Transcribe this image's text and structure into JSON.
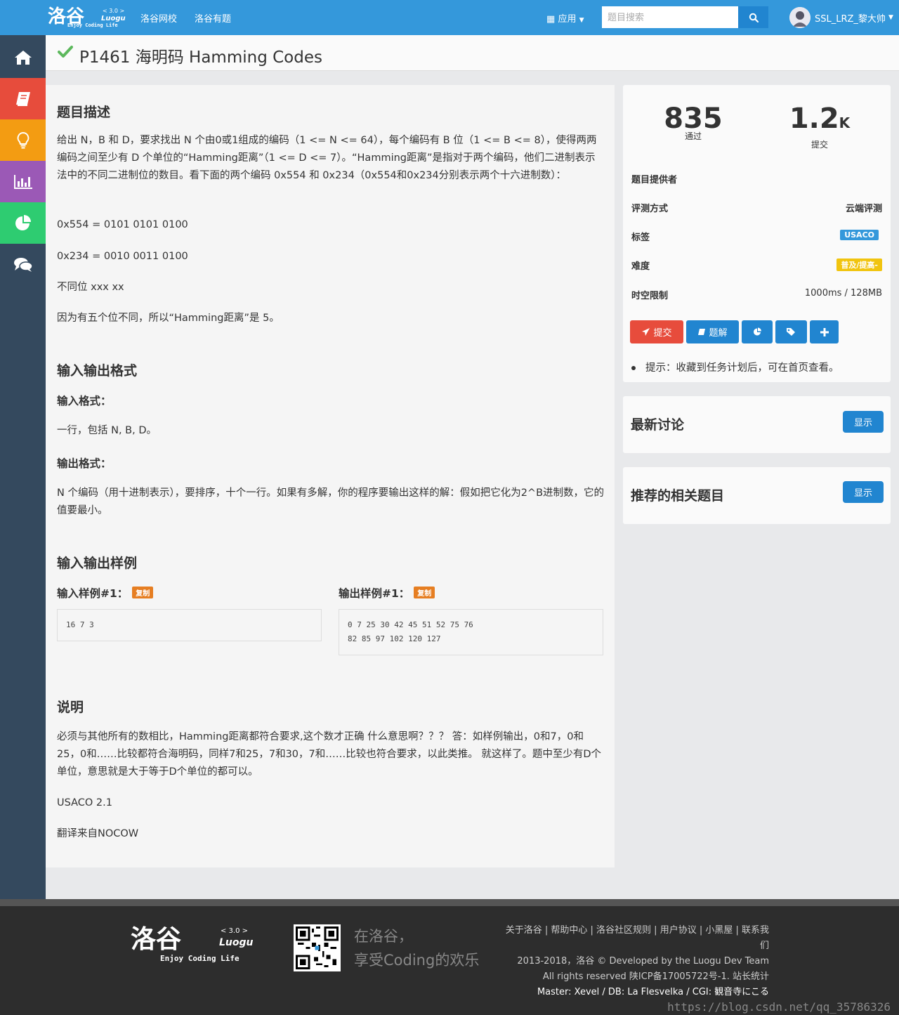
{
  "header": {
    "logo_text": "洛谷",
    "logo_version": "< 3.0 >",
    "logo_name": "Luogu",
    "logo_slogan": "Enjoy Coding Life",
    "nav": [
      "洛谷网校",
      "洛谷有题"
    ],
    "apps_label": "应用",
    "search_placeholder": "题目搜索",
    "username": "SSL_LRZ_黎大帅"
  },
  "sidebar": {
    "items": [
      {
        "icon": "home-icon",
        "color": "#34495e"
      },
      {
        "icon": "book-icon",
        "color": "#e74c3c"
      },
      {
        "icon": "lightbulb-icon",
        "color": "#f39c12"
      },
      {
        "icon": "bar-chart-icon",
        "color": "#9b59b6"
      },
      {
        "icon": "pie-chart-icon",
        "color": "#2ecc71"
      },
      {
        "icon": "comments-icon",
        "color": "#34495e"
      }
    ]
  },
  "problem": {
    "title": "P1461 海明码 Hamming Codes",
    "desc_heading": "题目描述",
    "desc_p1": "给出 N，B 和 D，要求找出 N 个由0或1组成的编码（1 <= N <= 64），每个编码有 B 位（1 <= B <= 8），使得两两编码之间至少有 D 个单位的“Hamming距离”（1 <= D <= 7）。“Hamming距离”是指对于两个编码，他们二进制表示法中的不同二进制位的数目。看下面的两个编码 0x554 和 0x234（0x554和0x234分别表示两个十六进制数）：",
    "desc_p2": "0x554 = 0101 0101 0100",
    "desc_p3": "0x234 = 0010 0011 0100",
    "desc_p4": "不同位 xxx xx",
    "desc_p5": "因为有五个位不同，所以“Hamming距离”是 5。",
    "io_heading": "输入输出格式",
    "input_format_label": "输入格式：",
    "input_format": "一行，包括 N, B, D。",
    "output_format_label": "输出格式：",
    "output_format": "N 个编码（用十进制表示），要排序，十个一行。如果有多解，你的程序要输出这样的解：假如把它化为2^B进制数，它的值要最小。",
    "sample_heading": "输入输出样例",
    "sample_in_label": "输入样例#1：",
    "sample_out_label": "输出样例#1：",
    "copy_label": "复制",
    "sample_in": "16 7 3",
    "sample_out_line1": "0 7 25 30 42 45 51 52 75 76",
    "sample_out_line2": "82 85 97 102 120 127",
    "note_heading": "说明",
    "note_p1": "必须与其他所有的数相比，Hamming距离都符合要求,这个数才正确 什么意思啊？？？ 答：如样例输出，0和7，0和25，0和……比较都符合海明码，同样7和25，7和30，7和……比较也符合要求，以此类推。 就这样了。题中至少有D个单位，意思就是大于等于D个单位的都可以。",
    "note_p2": "USACO 2.1",
    "note_p3": "翻译来自NOCOW"
  },
  "info": {
    "passed": "835",
    "passed_label": "通过",
    "submitted": "1.2",
    "submitted_unit": "K",
    "submitted_label": "提交",
    "provider_label": "题目提供者",
    "judge_label": "评测方式",
    "judge_value": "云端评测",
    "tags_label": "标签",
    "tag": "USACO",
    "tag_color": "#3498db",
    "difficulty_label": "难度",
    "difficulty": "普及/提高-",
    "difficulty_color": "#f1c40f",
    "limit_label": "时空限制",
    "limit_value": "1000ms / 128MB",
    "submit_btn": "提交",
    "solution_btn": "题解",
    "hint": "提示：收藏到任务计划后，可在首页查看。"
  },
  "discussion": {
    "heading": "最新讨论",
    "button": "显示"
  },
  "related": {
    "heading": "推荐的相关题目",
    "button": "显示"
  },
  "footer": {
    "slogan_line1": "在洛谷，",
    "slogan_line2": "享受Coding的欢乐",
    "links_line1": "关于洛谷 | 帮助中心 | 洛谷社区规则 | 用户协议 | 小黑屋 | 联系我们",
    "copyright": "2013-2018，洛谷 © Developed by the Luogu Dev Team",
    "rights": "All rights reserved 陕ICP备17005722号-1. 站长统计",
    "servers": "Master: Xevel / DB: La Flesvelka / CGI: 観音寺にこる",
    "watermark": "https://blog.csdn.net/qq_35786326"
  }
}
